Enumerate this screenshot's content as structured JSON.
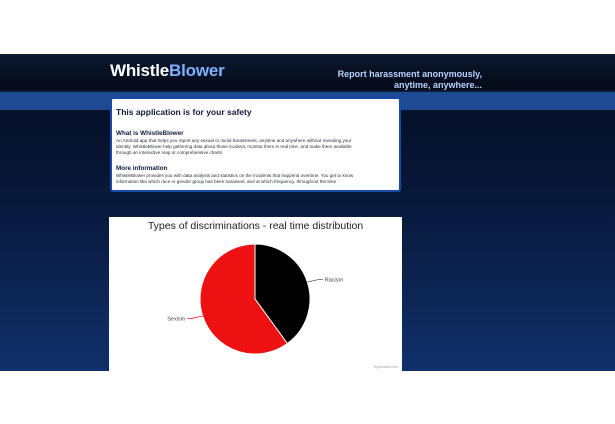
{
  "header": {
    "brand_part1": "Whistle",
    "brand_part2": "Blower",
    "tagline_line1": "Report harassment anonymously,",
    "tagline_line2": "anytime, anywhere..."
  },
  "info": {
    "title": "This application is for your safety",
    "section1_heading": "What is WhistleBlower",
    "section1_line1": "An Android app that helps you report any sexual or racial harassment, anytime and anywhere without revealing your",
    "section1_line2": "identity. WhistleBlower help gathering data about those incident, monitor them in real time, and make them available",
    "section1_line3": "through an interactive map or comprehensive charts",
    "section2_heading": "More information",
    "section2_line1": "WhistleBlower provides you with data analysis and statistics on the incidents that happend overtime. You get to know",
    "section2_line2": "information like which race or gender group has been harassed, and at which frequency, throughout the time"
  },
  "chart_data": {
    "type": "pie",
    "title": "Types of discriminations - real time distribution",
    "categories": [
      "Racism",
      "Sexism"
    ],
    "values": [
      40,
      60
    ],
    "colors": [
      "#000000",
      "#ee1111"
    ],
    "credit": "Highcharts.com"
  }
}
